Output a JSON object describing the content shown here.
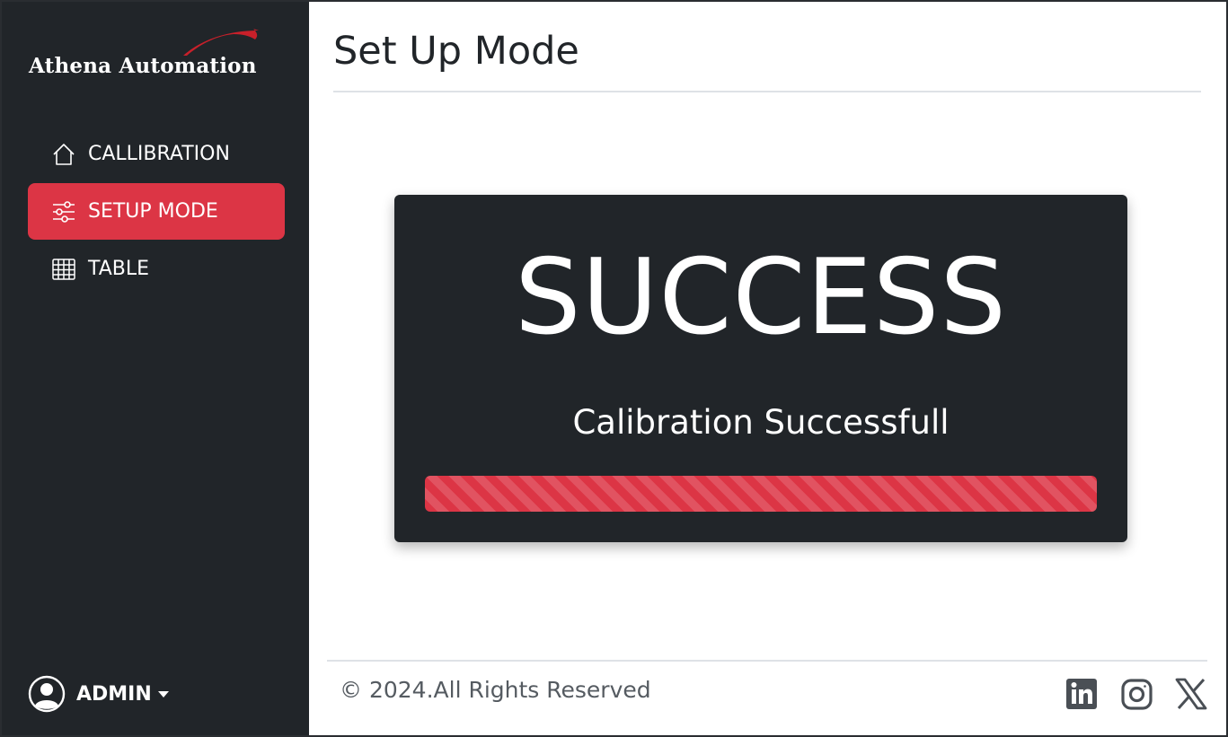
{
  "brand": {
    "logo_text": "Athena Automation",
    "accent": "#dc3545",
    "sidebar_bg": "#212529"
  },
  "sidebar": {
    "items": [
      {
        "label": "CALLIBRATION",
        "icon": "home-icon",
        "active": false
      },
      {
        "label": "SETUP MODE",
        "icon": "sliders-icon",
        "active": true
      },
      {
        "label": "TABLE",
        "icon": "table-icon",
        "active": false
      }
    ],
    "user": {
      "name": "ADMIN",
      "icon": "user-circle-icon"
    }
  },
  "main": {
    "title": "Set Up Mode",
    "status_card": {
      "heading": "SUCCESS",
      "message": "Calibration Successfull",
      "progress_percent": 100,
      "progress_color": "#dc3545"
    }
  },
  "footer": {
    "copyright": "© 2024.All Rights Reserved",
    "social": [
      "linkedin-icon",
      "instagram-icon",
      "x-icon"
    ]
  }
}
